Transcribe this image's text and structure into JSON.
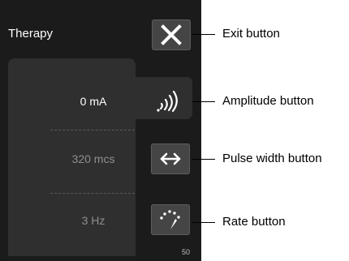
{
  "screen": {
    "title": "Therapy",
    "amplitude": "0 mA",
    "pulse_width": "320 mcs",
    "rate": "3 Hz",
    "page_number": "50"
  },
  "callouts": {
    "exit": "Exit button",
    "amplitude": "Amplitude button",
    "pulse_width": "Pulse width button",
    "rate": "Rate button"
  },
  "icons": {
    "exit": "close-icon",
    "amplitude": "signal-waves-icon",
    "pulse_width": "double-arrow-icon",
    "rate": "rate-gauge-icon"
  },
  "colors": {
    "background": "#1b1b1b",
    "panel": "#2f2f2f",
    "button": "#454545",
    "active_text": "#ffffff",
    "inactive_text": "#8f8f8f"
  }
}
